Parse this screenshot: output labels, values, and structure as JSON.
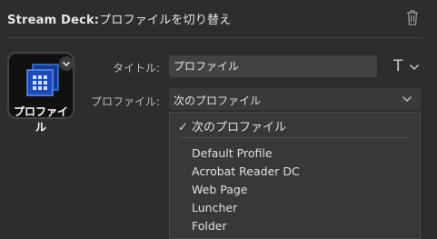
{
  "header": {
    "app": "Stream Deck:",
    "action": "プロファイルを切り替え"
  },
  "tile": {
    "label": "プロファイル"
  },
  "form": {
    "title_label": "タイトル:",
    "title_value": "プロファイル",
    "title_style_glyph": "T",
    "profile_label": "プロファイル:",
    "profile_value": "次のプロファイル"
  },
  "dropdown": {
    "check": "✓",
    "selected": "次のプロファイル",
    "options": [
      "Default Profile",
      "Acrobat Reader DC",
      "Web Page",
      "Luncher",
      "Folder"
    ]
  },
  "colors": {
    "background": "#2d2d2d",
    "tile_background": "#111111",
    "icon_blue": "#2c5fd6"
  }
}
